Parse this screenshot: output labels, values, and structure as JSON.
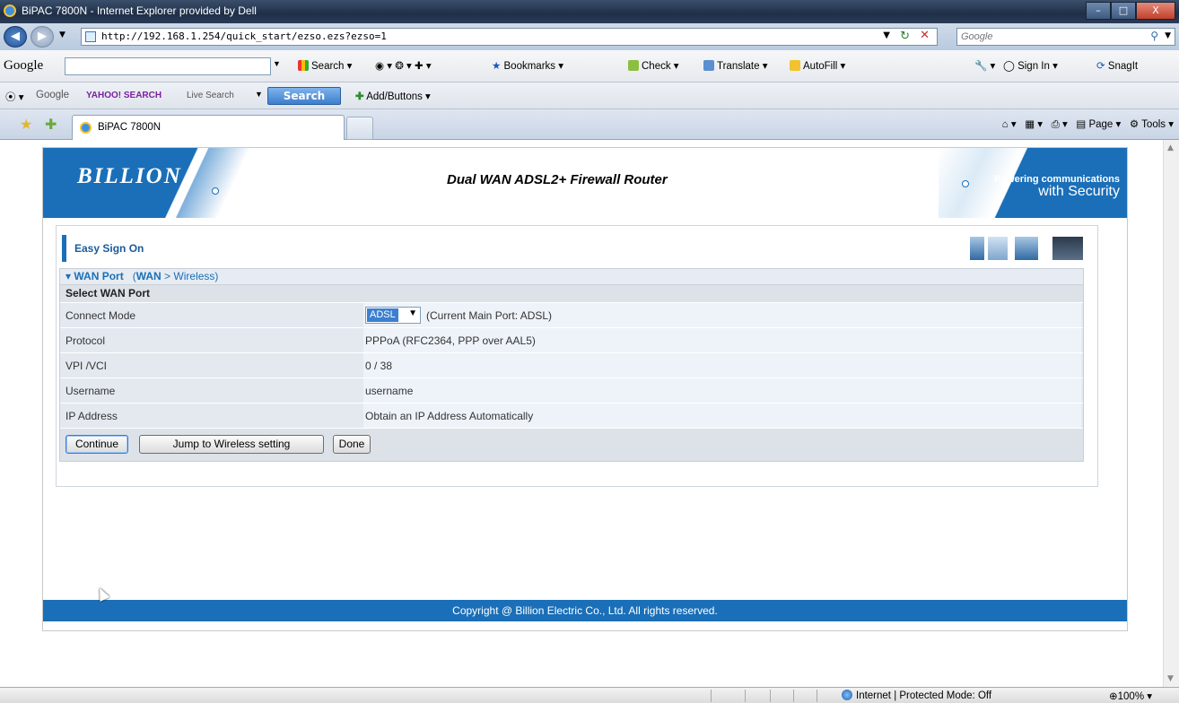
{
  "window": {
    "title": "BiPAC 7800N - Internet Explorer provided by Dell",
    "min": "–",
    "max": "□",
    "close": "X"
  },
  "address": {
    "url": "http://192.168.1.254/quick_start/ezso.ezs?ezso=1",
    "search_placeholder": "Google"
  },
  "google_toolbar": {
    "logo": "Google",
    "search_label": "Search",
    "bookmarks": "Bookmarks",
    "check": "Check",
    "translate": "Translate",
    "autofill": "AutoFill",
    "sign_in": "Sign In",
    "snagit": "SnagIt"
  },
  "yahoo_toolbar": {
    "google": "Google",
    "yahoo": "YAHOO! SEARCH",
    "live": "Live Search",
    "search_btn": "Search",
    "add_buttons": "Add/Buttons"
  },
  "tabs": {
    "active": "BiPAC 7800N"
  },
  "command_bar": {
    "page": "Page",
    "tools": "Tools"
  },
  "banner": {
    "brand": "BILLION",
    "product": "Dual WAN ADSL2+ Firewall Router",
    "slogan_line1": "Powering communications",
    "slogan_line2": "with Security"
  },
  "easy": {
    "heading": "Easy Sign On"
  },
  "wan": {
    "section": "WAN Port",
    "section_path_wan": "WAN",
    "section_path_sep": ">",
    "section_path_wireless": "Wireless",
    "subheading": "Select WAN Port",
    "rows": [
      {
        "label": "Connect Mode",
        "value": "ADSL"
      },
      {
        "label": "Protocol",
        "value": "PPPoA (RFC2364, PPP over AAL5)"
      },
      {
        "label": "VPI /VCI",
        "value": "0 / 38"
      },
      {
        "label": "Username",
        "value": "username"
      },
      {
        "label": "IP Address",
        "value": "Obtain an IP Address Automatically"
      }
    ],
    "connect_note": "(Current Main Port: ADSL)",
    "buttons": {
      "continue": "Continue",
      "jump": "Jump to Wireless setting",
      "done": "Done"
    }
  },
  "footer": {
    "copyright": "Copyright @ Billion Electric Co., Ltd. All rights reserved."
  },
  "status": {
    "zone": "Internet | Protected Mode: Off",
    "zoom": "100%"
  }
}
